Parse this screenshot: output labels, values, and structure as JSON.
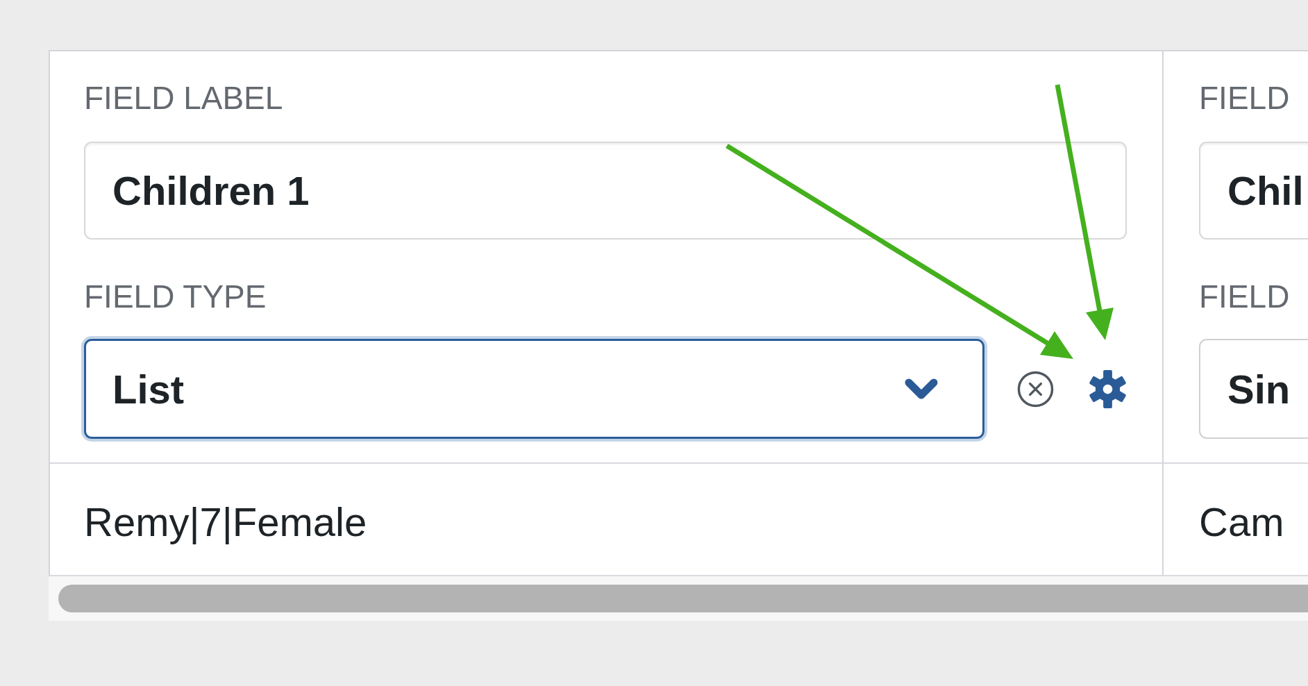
{
  "table": {
    "columns": [
      {
        "field_label": {
          "caption": "FIELD LABEL",
          "value": "Children 1"
        },
        "field_type": {
          "caption": "FIELD TYPE",
          "value": "List",
          "focused": true,
          "show_controls": true
        }
      },
      {
        "field_label": {
          "caption": "FIELD",
          "value": "Chil"
        },
        "field_type": {
          "caption": "FIELD",
          "value": "Sin",
          "focused": false,
          "show_controls": false
        }
      }
    ],
    "rows": [
      {
        "cells": [
          "Remy|7|Female",
          "Cam"
        ]
      }
    ]
  }
}
